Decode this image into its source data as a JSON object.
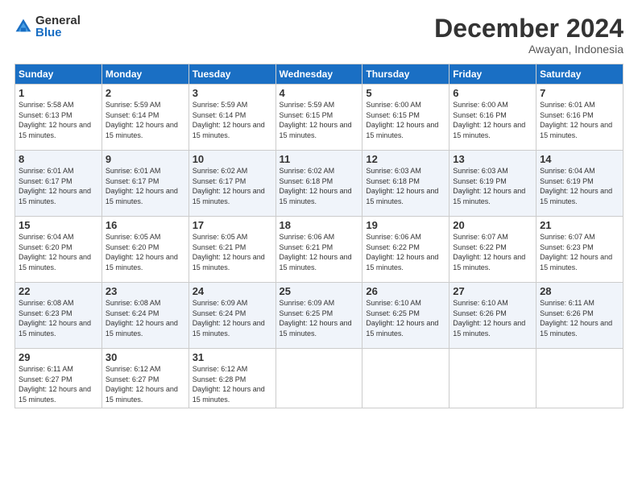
{
  "logo": {
    "general": "General",
    "blue": "Blue"
  },
  "header": {
    "month": "December 2024",
    "location": "Awayan, Indonesia"
  },
  "weekdays": [
    "Sunday",
    "Monday",
    "Tuesday",
    "Wednesday",
    "Thursday",
    "Friday",
    "Saturday"
  ],
  "weeks": [
    [
      {
        "day": "1",
        "sunrise": "5:58 AM",
        "sunset": "6:13 PM",
        "daylight": "12 hours and 15 minutes."
      },
      {
        "day": "2",
        "sunrise": "5:59 AM",
        "sunset": "6:14 PM",
        "daylight": "12 hours and 15 minutes."
      },
      {
        "day": "3",
        "sunrise": "5:59 AM",
        "sunset": "6:14 PM",
        "daylight": "12 hours and 15 minutes."
      },
      {
        "day": "4",
        "sunrise": "5:59 AM",
        "sunset": "6:15 PM",
        "daylight": "12 hours and 15 minutes."
      },
      {
        "day": "5",
        "sunrise": "6:00 AM",
        "sunset": "6:15 PM",
        "daylight": "12 hours and 15 minutes."
      },
      {
        "day": "6",
        "sunrise": "6:00 AM",
        "sunset": "6:16 PM",
        "daylight": "12 hours and 15 minutes."
      },
      {
        "day": "7",
        "sunrise": "6:01 AM",
        "sunset": "6:16 PM",
        "daylight": "12 hours and 15 minutes."
      }
    ],
    [
      {
        "day": "8",
        "sunrise": "6:01 AM",
        "sunset": "6:17 PM",
        "daylight": "12 hours and 15 minutes."
      },
      {
        "day": "9",
        "sunrise": "6:01 AM",
        "sunset": "6:17 PM",
        "daylight": "12 hours and 15 minutes."
      },
      {
        "day": "10",
        "sunrise": "6:02 AM",
        "sunset": "6:17 PM",
        "daylight": "12 hours and 15 minutes."
      },
      {
        "day": "11",
        "sunrise": "6:02 AM",
        "sunset": "6:18 PM",
        "daylight": "12 hours and 15 minutes."
      },
      {
        "day": "12",
        "sunrise": "6:03 AM",
        "sunset": "6:18 PM",
        "daylight": "12 hours and 15 minutes."
      },
      {
        "day": "13",
        "sunrise": "6:03 AM",
        "sunset": "6:19 PM",
        "daylight": "12 hours and 15 minutes."
      },
      {
        "day": "14",
        "sunrise": "6:04 AM",
        "sunset": "6:19 PM",
        "daylight": "12 hours and 15 minutes."
      }
    ],
    [
      {
        "day": "15",
        "sunrise": "6:04 AM",
        "sunset": "6:20 PM",
        "daylight": "12 hours and 15 minutes."
      },
      {
        "day": "16",
        "sunrise": "6:05 AM",
        "sunset": "6:20 PM",
        "daylight": "12 hours and 15 minutes."
      },
      {
        "day": "17",
        "sunrise": "6:05 AM",
        "sunset": "6:21 PM",
        "daylight": "12 hours and 15 minutes."
      },
      {
        "day": "18",
        "sunrise": "6:06 AM",
        "sunset": "6:21 PM",
        "daylight": "12 hours and 15 minutes."
      },
      {
        "day": "19",
        "sunrise": "6:06 AM",
        "sunset": "6:22 PM",
        "daylight": "12 hours and 15 minutes."
      },
      {
        "day": "20",
        "sunrise": "6:07 AM",
        "sunset": "6:22 PM",
        "daylight": "12 hours and 15 minutes."
      },
      {
        "day": "21",
        "sunrise": "6:07 AM",
        "sunset": "6:23 PM",
        "daylight": "12 hours and 15 minutes."
      }
    ],
    [
      {
        "day": "22",
        "sunrise": "6:08 AM",
        "sunset": "6:23 PM",
        "daylight": "12 hours and 15 minutes."
      },
      {
        "day": "23",
        "sunrise": "6:08 AM",
        "sunset": "6:24 PM",
        "daylight": "12 hours and 15 minutes."
      },
      {
        "day": "24",
        "sunrise": "6:09 AM",
        "sunset": "6:24 PM",
        "daylight": "12 hours and 15 minutes."
      },
      {
        "day": "25",
        "sunrise": "6:09 AM",
        "sunset": "6:25 PM",
        "daylight": "12 hours and 15 minutes."
      },
      {
        "day": "26",
        "sunrise": "6:10 AM",
        "sunset": "6:25 PM",
        "daylight": "12 hours and 15 minutes."
      },
      {
        "day": "27",
        "sunrise": "6:10 AM",
        "sunset": "6:26 PM",
        "daylight": "12 hours and 15 minutes."
      },
      {
        "day": "28",
        "sunrise": "6:11 AM",
        "sunset": "6:26 PM",
        "daylight": "12 hours and 15 minutes."
      }
    ],
    [
      {
        "day": "29",
        "sunrise": "6:11 AM",
        "sunset": "6:27 PM",
        "daylight": "12 hours and 15 minutes."
      },
      {
        "day": "30",
        "sunrise": "6:12 AM",
        "sunset": "6:27 PM",
        "daylight": "12 hours and 15 minutes."
      },
      {
        "day": "31",
        "sunrise": "6:12 AM",
        "sunset": "6:28 PM",
        "daylight": "12 hours and 15 minutes."
      },
      null,
      null,
      null,
      null
    ]
  ],
  "labels": {
    "sunrise": "Sunrise:",
    "sunset": "Sunset:",
    "daylight": "Daylight:"
  }
}
